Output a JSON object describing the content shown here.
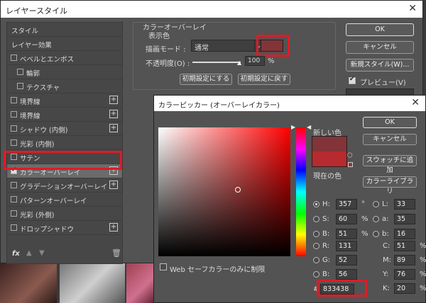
{
  "layer_style": {
    "title": "レイヤースタイル",
    "close_glyph": "✕",
    "styles_list": [
      {
        "label": "スタイル",
        "checkbox": false,
        "plus": false,
        "checked": false
      },
      {
        "label": "レイヤー効果",
        "checkbox": false,
        "plus": false,
        "checked": false
      },
      {
        "label": "ベベルとエンボス",
        "checkbox": true,
        "plus": false,
        "checked": false
      },
      {
        "label": "輪郭",
        "checkbox": true,
        "plus": false,
        "checked": false
      },
      {
        "label": "テクスチャ",
        "checkbox": true,
        "plus": false,
        "checked": false
      },
      {
        "label": "境界線",
        "checkbox": true,
        "plus": true,
        "checked": false
      },
      {
        "label": "境界線",
        "checkbox": true,
        "plus": true,
        "checked": false
      },
      {
        "label": "シャドウ (内側)",
        "checkbox": true,
        "plus": true,
        "checked": false
      },
      {
        "label": "光彩 (内側)",
        "checkbox": true,
        "plus": false,
        "checked": false
      },
      {
        "label": "サテン",
        "checkbox": true,
        "plus": false,
        "checked": false
      },
      {
        "label": "カラーオーバーレイ",
        "checkbox": true,
        "plus": true,
        "checked": true
      },
      {
        "label": "グラデーションオーバーレイ",
        "checkbox": true,
        "plus": true,
        "checked": false
      },
      {
        "label": "パターンオーバーレイ",
        "checkbox": true,
        "plus": false,
        "checked": false
      },
      {
        "label": "光彩 (外側)",
        "checkbox": true,
        "plus": false,
        "checked": false
      },
      {
        "label": "ドロップシャドウ",
        "checkbox": true,
        "plus": true,
        "checked": false
      }
    ],
    "fx_label": "fx",
    "overlay": {
      "section_title": "カラーオーバーレイ",
      "group_title": "表示色",
      "blend_mode_label": "描画モード :",
      "blend_mode_value": "通常",
      "opacity_label": "不透明度(O) :",
      "opacity_value": "100",
      "opacity_unit": "%",
      "make_default": "初期設定にする",
      "reset_default": "初期設定に戻す",
      "swatch_color": "#833438"
    },
    "buttons": {
      "ok": "OK",
      "cancel": "キャンセル",
      "new_style": "新規スタイル(W)...",
      "preview": "プレビュー(V)"
    }
  },
  "color_picker": {
    "title": "カラーピッカー (オーバーレイカラー)",
    "close_glyph": "✕",
    "new_label": "新しい色",
    "current_label": "現在の色",
    "new_color": "#833438",
    "current_color": "#b72a2f",
    "buttons": {
      "ok": "OK",
      "cancel": "キャンセル",
      "add_swatch": "スウォッチに追加",
      "libraries": "カラーライブラリ"
    },
    "web_only_label": "Web セーフカラーのみに制限",
    "hsb": [
      {
        "label": "H:",
        "value": "357",
        "unit": "°",
        "selected": true
      },
      {
        "label": "S:",
        "value": "60",
        "unit": "%",
        "selected": false
      },
      {
        "label": "B:",
        "value": "51",
        "unit": "%",
        "selected": false
      }
    ],
    "rgb": [
      {
        "label": "R:",
        "value": "131"
      },
      {
        "label": "G:",
        "value": "52"
      },
      {
        "label": "B:",
        "value": "56"
      }
    ],
    "lab": [
      {
        "label": "L:",
        "value": "33"
      },
      {
        "label": "a:",
        "value": "35"
      },
      {
        "label": "b:",
        "value": "16"
      }
    ],
    "cmyk": [
      {
        "label": "C:",
        "value": "51",
        "unit": "%"
      },
      {
        "label": "M:",
        "value": "89",
        "unit": "%"
      },
      {
        "label": "Y:",
        "value": "76",
        "unit": "%"
      },
      {
        "label": "K:",
        "value": "20",
        "unit": "%"
      }
    ],
    "hex_label": "#",
    "hex_value": "833438"
  },
  "colors": {
    "highlight": "#e11a26",
    "dialog_bg": "#535353"
  }
}
